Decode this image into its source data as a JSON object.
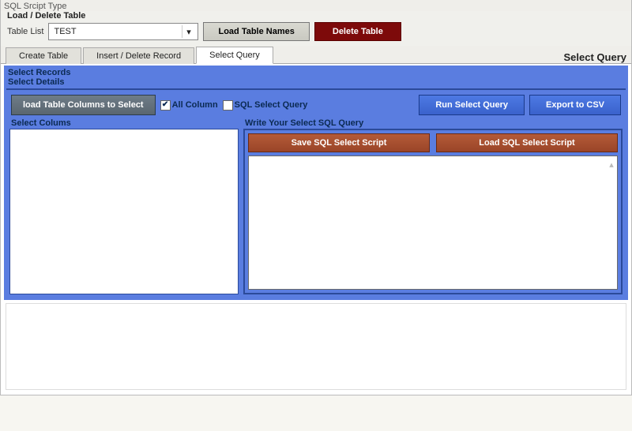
{
  "window": {
    "title": "SQL Srcipt Type"
  },
  "loadDelete": {
    "title": "Load / Delete Table",
    "tableListLabel": "Table List",
    "tableListValue": "TEST",
    "loadBtn": "Load Table Names",
    "deleteBtn": "Delete Table"
  },
  "tabs": {
    "items": [
      {
        "label": "Create Table"
      },
      {
        "label": "Insert / Delete Record"
      },
      {
        "label": "Select Query"
      }
    ],
    "activeIndex": 2,
    "rightLabel": "Select Query"
  },
  "selectPanel": {
    "recordsTitle": "Select Records",
    "detailsTitle": "Select Details",
    "loadColsBtn": "load Table Columns to Select",
    "allColumnLabel": "All Column",
    "allColumnChecked": true,
    "sqlSelectQueryLabel": "SQL Select Query",
    "sqlSelectQueryChecked": false,
    "runBtn": "Run Select Query",
    "exportBtn": "Export to CSV",
    "selectColumnsTitle": "Select Colums",
    "writeQueryTitle": "Write Your Select SQL Query",
    "saveScriptBtn": "Save SQL Select Script",
    "loadScriptBtn": "Load SQL Select Script",
    "queryText": ""
  },
  "glyphs": {
    "check": "✔",
    "caretDown": "▾",
    "scrollUp": "▴"
  }
}
